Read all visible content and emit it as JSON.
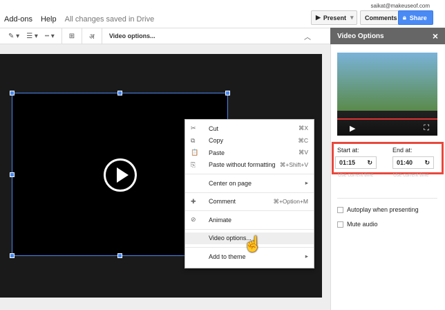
{
  "account": {
    "email": "saikat@makeuseof.com"
  },
  "menu": {
    "items": [
      "Add-ons",
      "Help"
    ],
    "status": "All changes saved in Drive"
  },
  "header": {
    "present": "Present",
    "comments": "Comments",
    "share": "Share"
  },
  "toolbar": {
    "video_options": "Video options...",
    "lang_glyph": "अ"
  },
  "panel": {
    "title": "Video Options",
    "close": "×",
    "start_label": "Start at:",
    "start_value": "01:15",
    "end_label": "End at:",
    "end_value": "01:40",
    "use_current": "Use current time",
    "autoplay": "Autoplay when presenting",
    "mute": "Mute audio"
  },
  "context_menu": [
    {
      "icon": "✂",
      "label": "Cut",
      "shortcut": "⌘X"
    },
    {
      "icon": "⧉",
      "label": "Copy",
      "shortcut": "⌘C"
    },
    {
      "icon": "📋",
      "label": "Paste",
      "shortcut": "⌘V"
    },
    {
      "icon": "⎘",
      "label": "Paste without formatting",
      "shortcut": "⌘+Shift+V"
    },
    {
      "icon": "",
      "label": "Center on page",
      "shortcut": "▸"
    },
    {
      "icon": "✚",
      "label": "Comment",
      "shortcut": "⌘+Option+M"
    },
    {
      "icon": "⊘",
      "label": "Animate",
      "shortcut": ""
    },
    {
      "icon": "",
      "label": "Video options...",
      "shortcut": ""
    },
    {
      "icon": "",
      "label": "Add to theme",
      "shortcut": "▸"
    }
  ]
}
